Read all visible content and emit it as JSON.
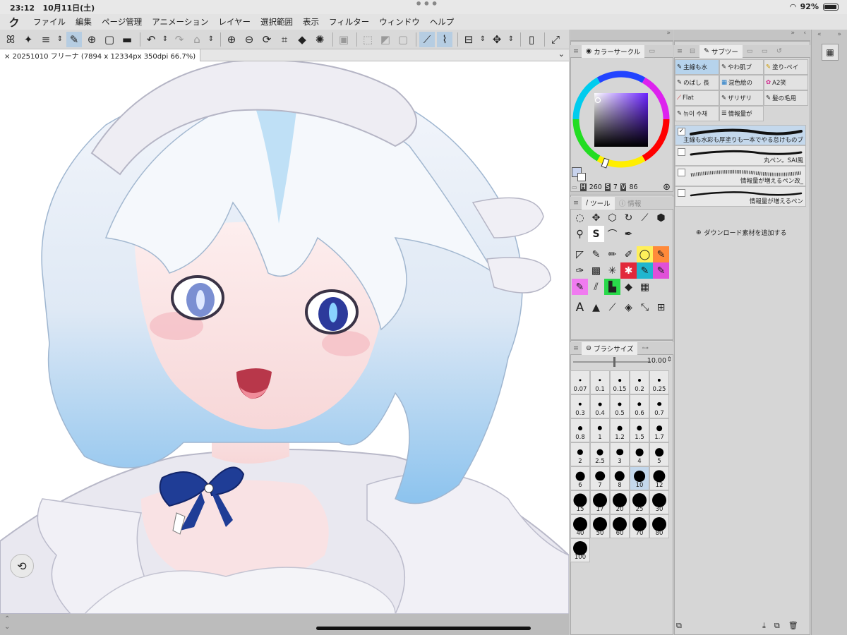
{
  "status": {
    "time": "23:12",
    "date": "10月11日(土)",
    "battery": "92%",
    "battery_level": 0.92
  },
  "menu": [
    "ファイル",
    "編集",
    "ページ管理",
    "アニメーション",
    "レイヤー",
    "選択範囲",
    "表示",
    "フィルター",
    "ウィンドウ",
    "ヘルプ"
  ],
  "document": {
    "tab": "20251010 フリーナ (7894 x 12334px 350dpi 66.7%)"
  },
  "color_panel": {
    "title": "カラーサークル",
    "h": "260",
    "s": "7",
    "v": "86",
    "h_label": "H",
    "s_label": "S",
    "v_label": "V"
  },
  "tool_panel": {
    "tab1": "ツール",
    "tab2": "情報"
  },
  "subtool_panel": {
    "title": "サブツー",
    "cells": [
      [
        "主線も水",
        "やわ肌ブ",
        "塗り-ペイ"
      ],
      [
        "のばし 長",
        "混色絵の",
        "A2笑"
      ],
      [
        "Flat",
        "ザリザリ",
        "髪の毛用"
      ],
      [
        "뉴이 수채",
        "情報量が",
        ""
      ]
    ]
  },
  "brushes": [
    {
      "name": "主線も水彩も厚塗りも一本でやる怠けものブ",
      "checked": true,
      "selected": true
    },
    {
      "name": "丸ペン。SAI風",
      "checked": false,
      "selected": false
    },
    {
      "name": "情報量が増えるペン改_",
      "checked": false,
      "selected": false
    },
    {
      "name": "情報量が増えるペン",
      "checked": false,
      "selected": false
    }
  ],
  "add_material": "ダウンロード素材を追加する",
  "brush_size": {
    "title": "ブラシサイズ",
    "value": "10.00",
    "sizes": [
      "0.07",
      "0.1",
      "0.15",
      "0.2",
      "0.25",
      "0.3",
      "0.4",
      "0.5",
      "0.6",
      "0.7",
      "0.8",
      "1",
      "1.2",
      "1.5",
      "1.7",
      "2",
      "2.5",
      "3",
      "4",
      "5",
      "6",
      "7",
      "8",
      "10",
      "12",
      "15",
      "17",
      "20",
      "25",
      "30",
      "40",
      "50",
      "60",
      "70",
      "80",
      "100"
    ],
    "selected": "10"
  },
  "colors": {
    "accent": "#b6cde2",
    "main_color": "#3a3152"
  }
}
